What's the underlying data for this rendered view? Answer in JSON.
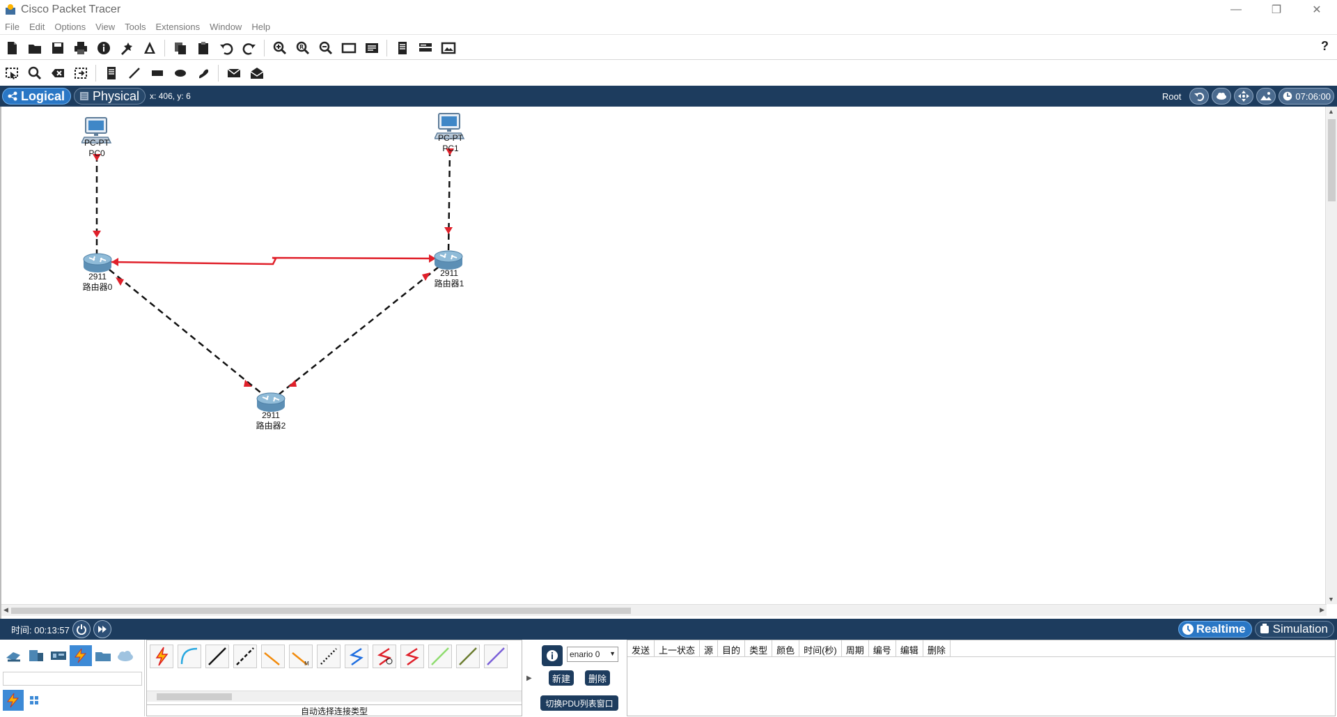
{
  "window": {
    "title": "Cisco Packet Tracer",
    "controls": [
      "minimize",
      "maximize",
      "close"
    ]
  },
  "menu": [
    "File",
    "Edit",
    "Options",
    "View",
    "Tools",
    "Extensions",
    "Window",
    "Help"
  ],
  "toolbar_main": {
    "icons": [
      "new-icon",
      "open-icon",
      "save-icon",
      "print-icon",
      "info-icon",
      "activity-wizard-icon",
      "custom-device-icon",
      "copy-icon",
      "paste-icon",
      "undo-icon",
      "redo-icon",
      "zoom-in-icon",
      "zoom-reset-icon",
      "zoom-out-icon",
      "drawing-palette-icon",
      "custom-devices-dialog-icon",
      "notes-icon",
      "device-template-icon",
      "screenshot-icon"
    ],
    "help_label": "?"
  },
  "toolbar_common": {
    "icons": [
      "select-icon",
      "inspect-icon",
      "delete-icon",
      "resize-shape-icon",
      "place-note-icon",
      "draw-line-icon",
      "draw-rectangle-icon",
      "draw-ellipse-icon",
      "freeform-icon",
      "add-simple-pdu-icon",
      "add-complex-pdu-icon"
    ]
  },
  "modebar": {
    "logical_label": "Logical",
    "physical_label": "Physical",
    "coords": "x: 406, y: 6",
    "root_label": "Root",
    "time": "07:06:00"
  },
  "topology": {
    "devices": [
      {
        "id": "pc0",
        "model": "PC-PT",
        "name": "PC0",
        "type": "pc"
      },
      {
        "id": "pc1",
        "model": "PC-PT",
        "name": "PC1",
        "type": "pc"
      },
      {
        "id": "router0",
        "model": "2911",
        "name": "路由器0",
        "type": "router"
      },
      {
        "id": "router1",
        "model": "2911",
        "name": "路由器1",
        "type": "router"
      },
      {
        "id": "router2",
        "model": "2911",
        "name": "路由器2",
        "type": "router"
      }
    ],
    "links": [
      {
        "from": "pc0",
        "to": "router0",
        "type": "copper-cross-over",
        "status": "down"
      },
      {
        "from": "pc1",
        "to": "router1",
        "type": "copper-cross-over",
        "status": "down"
      },
      {
        "from": "router0",
        "to": "router1",
        "type": "serial-dce",
        "status": "down"
      },
      {
        "from": "router0",
        "to": "router2",
        "type": "copper-cross-over",
        "status": "down"
      },
      {
        "from": "router1",
        "to": "router2",
        "type": "copper-cross-over",
        "status": "down"
      }
    ]
  },
  "statusbar": {
    "timer_label": "时间: 00:13:57",
    "realtime_label": "Realtime",
    "simulation_label": "Simulation"
  },
  "device_panel": {
    "categories": [
      "network-devices-icon",
      "end-devices-icon",
      "components-icon",
      "connections-icon",
      "miscellaneous-icon",
      "multiuser-icon"
    ],
    "selected_category": "connections-icon",
    "connection_types": [
      "automatic-connection-icon",
      "console-cable-icon",
      "copper-straight-through-icon",
      "copper-cross-over-icon",
      "fiber-icon",
      "phone-cable-icon",
      "coaxial-icon",
      "serial-dce-icon",
      "serial-dte-icon",
      "octal-cable-icon",
      "iot-custom-cable-icon",
      "usb-cable-icon",
      "wireless-cable-icon"
    ],
    "connection_description": "自动选择连接类型"
  },
  "pdu_panel": {
    "scenario": "enario 0",
    "new_label": "新建",
    "delete_label": "删除",
    "toggle_label": "切换PDU列表窗口",
    "columns": [
      "发送",
      "上一状态",
      "源",
      "目的",
      "类型",
      "颜色",
      "时间(秒)",
      "周期",
      "编号",
      "编辑",
      "删除"
    ]
  },
  "colors": {
    "modebar_bg": "#1d3c5e",
    "active_tab": "#2a77c5",
    "link_down": "#e0202a",
    "serial_link": "#e0202a"
  }
}
